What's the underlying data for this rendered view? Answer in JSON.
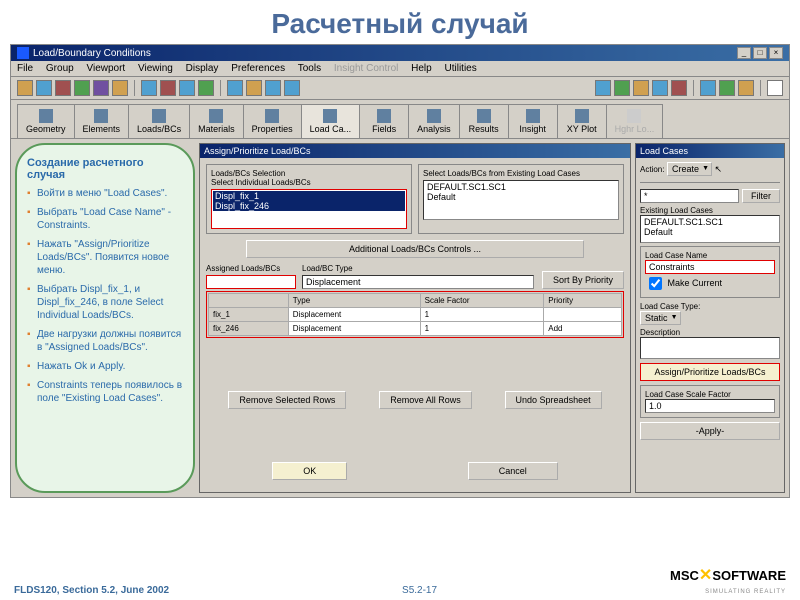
{
  "slide": {
    "title": "Расчетный случай",
    "pageref": "S5.2-17",
    "docref": "FLDS120, Section 5.2, June 2002"
  },
  "logo": {
    "name1": "MSC",
    "name2": "SOFTWARE",
    "tagline": "SIMULATING REALITY"
  },
  "titlebar": {
    "text": "Load/Boundary Conditions"
  },
  "menu": [
    "File",
    "Group",
    "Viewport",
    "Viewing",
    "Display",
    "Preferences",
    "Tools",
    "Insight Control",
    "Help",
    "Utilities"
  ],
  "tabs": [
    "Geometry",
    "Elements",
    "Loads/BCs",
    "Materials",
    "Properties",
    "Load Ca...",
    "Fields",
    "Analysis",
    "Results",
    "Insight",
    "XY Plot",
    "Hghr Lo..."
  ],
  "tabActive": 5,
  "callout": {
    "title": "Создание расчетного случая",
    "items": [
      "Войти в меню \"Load Cases\".",
      "Выбрать \"Load Case Name\" - Constraints.",
      "Нажать \"Assign/Prioritize Loads/BCs\". Появится новое меню.",
      "Выбрать Displ_fix_1, и Displ_fix_246, в поле Select Individual Loads/BCs.",
      "Две нагрузки должны появится в \"Assigned Loads/BCs\".",
      "Нажать Ok и Apply.",
      "Constraints теперь появилось в поле \"Existing Load Cases\"."
    ]
  },
  "assignPanel": {
    "title": "Assign/Prioritize Load/BCs",
    "selLabel": "Loads/BCs Selection",
    "selSub": "Select Individual Loads/BCs",
    "selItems": [
      "Displ_fix_1",
      "Displ_fix_246"
    ],
    "existLabel": "Select Loads/BCs from Existing Load Cases",
    "existItems": [
      "DEFAULT.SC1.SC1",
      "Default"
    ],
    "addlBtn": "Additional Loads/BCs Controls ...",
    "assignedLabel": "Assigned Loads/BCs",
    "typeLabel": "Load/BC Type",
    "typeVal": "Displacement",
    "sortBtn": "Sort By Priority",
    "hdr": [
      "",
      "Type",
      "Scale Factor",
      "Priority"
    ],
    "rows": [
      {
        "n": "fix_1",
        "t": "Displacement",
        "sf": "1",
        "p": ""
      },
      {
        "n": "fix_246",
        "t": "Displacement",
        "sf": "1",
        "p": "Add"
      }
    ],
    "btns1": [
      "Remove Selected Rows",
      "Remove All Rows",
      "Undo Spreadsheet"
    ],
    "btns2": [
      "OK",
      "Cancel"
    ]
  },
  "lcPanel": {
    "title": "Load Cases",
    "actionLbl": "Action:",
    "actionVal": "Create",
    "filterBtn": "Filter",
    "existLbl": "Existing Load Cases",
    "existItems": [
      "DEFAULT.SC1.SC1",
      "Default"
    ],
    "nameLbl": "Load Case Name",
    "nameVal": "Constraints",
    "makeCurrent": "Make Current",
    "typeLbl": "Load Case Type:",
    "typeVal": "Static",
    "descLbl": "Description",
    "assignBtn": "Assign/Prioritize Loads/BCs",
    "sfLbl": "Load Case Scale Factor",
    "sfVal": "1.0",
    "applyBtn": "-Apply-"
  }
}
